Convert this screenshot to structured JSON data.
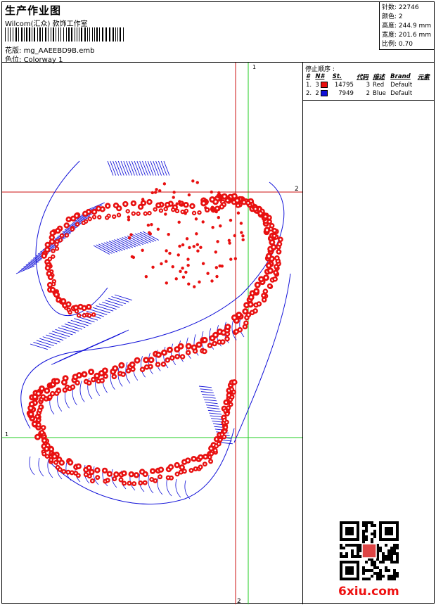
{
  "header": {
    "title": "生产作业图",
    "company": "Wilcom(汇众) 款饰工作室",
    "design_label": "花版",
    "design_file": "mg_AAEEBD9B.emb",
    "colorway_label": "色位",
    "colorway": "Colorway 1"
  },
  "stats": [
    {
      "label": "针数",
      "value": "22746"
    },
    {
      "label": "颜色",
      "value": "2"
    },
    {
      "label": "高度",
      "value": "244.9 mm"
    },
    {
      "label": "宽度",
      "value": "201.6 mm"
    },
    {
      "label": "比例",
      "value": "0.70"
    }
  ],
  "stop_sequence": {
    "title": "停止顺序 :",
    "columns": [
      "#",
      "N#",
      "St.",
      "代码",
      "描述",
      "Brand",
      "元素"
    ],
    "rows": [
      {
        "index": "1.",
        "needle": "3",
        "color": "#e81010",
        "stitches": "14795",
        "code": "3",
        "description": "Red",
        "brand": "Default"
      },
      {
        "index": "2.",
        "needle": "2",
        "color": "#1010d8",
        "stitches": "7949",
        "code": "2",
        "description": "Blue",
        "brand": "Default"
      }
    ]
  },
  "guides": {
    "label_1_top": "1",
    "label_2_right": "2",
    "label_1_left": "1",
    "label_2_bottom": "2"
  },
  "colors": {
    "red": "#e81010",
    "blue": "#1010d8",
    "guide_green": "#22cc22",
    "guide_red": "#cc1111"
  },
  "watermark": "6xiu.com",
  "qr_icon": "qr-code-icon"
}
